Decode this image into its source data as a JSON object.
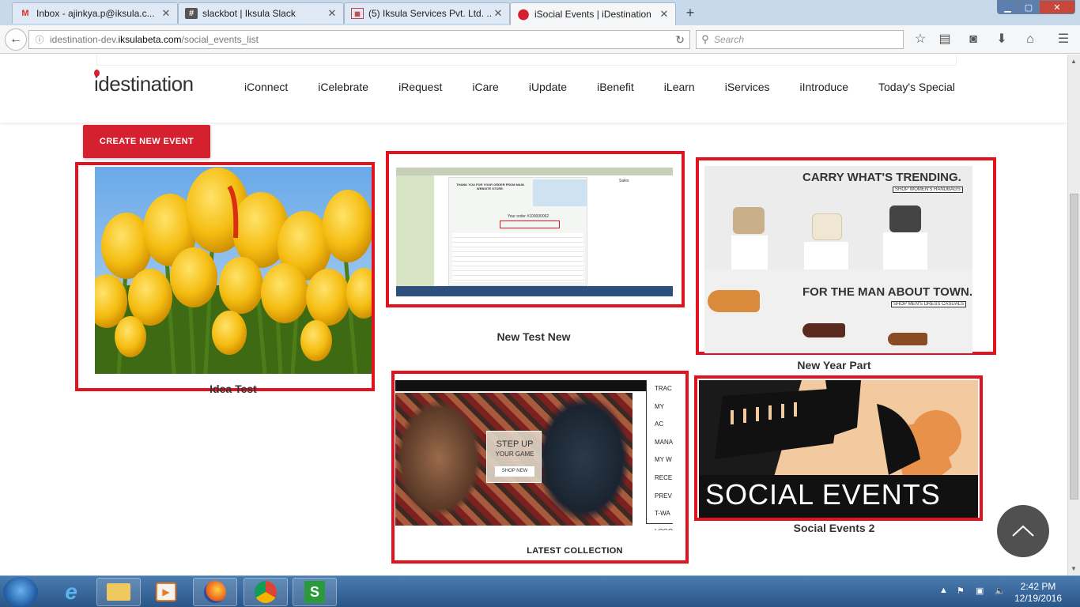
{
  "browser": {
    "tabs": [
      {
        "title": "Inbox - ajinkya.p@iksula.c...",
        "icon": "gmail-icon"
      },
      {
        "title": "slackbot | Iksula Slack",
        "icon": "slack-icon"
      },
      {
        "title": "(5) Iksula Services Pvt. Ltd. ...",
        "icon": "calendar-icon"
      },
      {
        "title": "iSocial Events | iDestination",
        "icon": "location-pin-icon"
      }
    ],
    "url_domain_prefix": "idestination-dev.",
    "url_domain": "iksulabeta.com",
    "url_path": "/social_events_list",
    "search_placeholder": "Search"
  },
  "site": {
    "logo": "idestination",
    "nav": [
      "iConnect",
      "iCelebrate",
      "iRequest",
      "iCare",
      "iUpdate",
      "iBenefit",
      "iLearn",
      "iServices",
      "iIntroduce",
      "Today's Special"
    ]
  },
  "create_button": "CREATE NEW EVENT",
  "events": [
    {
      "title": "Idea Test"
    },
    {
      "title": "New Test New"
    },
    {
      "title": "New Year Part"
    },
    {
      "title": "",
      "banner_lines": [
        "STEP UP",
        "YOUR GAME",
        "SHOP NEW"
      ],
      "menu": [
        "TRAC",
        "MY AC",
        "MANA",
        "MY W",
        "RECE",
        "PREV",
        "T-WA",
        "LOGO"
      ],
      "caption": "LATEST COLLECTION"
    },
    {
      "title": "Social Events 2",
      "banner": "SOCIAL EVENTS"
    }
  ],
  "ad": {
    "line1": "CARRY WHAT'S TRENDING.",
    "tag1": "SHOP WOMEN'S HANDBAGS",
    "line2": "FOR THE MAN ABOUT TOWN.",
    "tag2": "SHOP MEN'S DRESS CASUALS"
  },
  "email": {
    "header": "THANK YOU FOR YOUR ORDER FROM MAIN WEBSITE STORE.",
    "order": "Your order #100000062",
    "side": "Sales"
  },
  "taskbar": {
    "time": "2:42 PM",
    "date": "12/19/2016"
  },
  "colors": {
    "brand_red": "#d4202f",
    "card_border": "#e0131f"
  }
}
